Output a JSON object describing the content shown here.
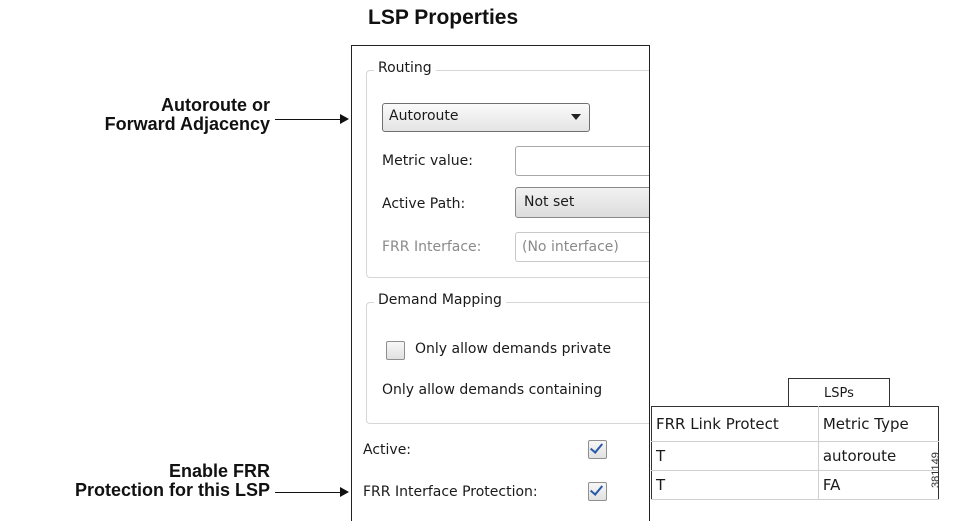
{
  "title": "LSP Properties",
  "callouts": {
    "autoroute_line1": "Autoroute or",
    "autoroute_line2": "Forward Adjacency",
    "frr_line1": "Enable FRR",
    "frr_line2": "Protection for this LSP"
  },
  "routing": {
    "group_label": "Routing",
    "autoroute_select": "Autoroute",
    "metric_label": "Metric value:",
    "metric_value": "",
    "active_path_label": "Active Path:",
    "active_path_value": "Not set",
    "frr_interface_label": "FRR Interface:",
    "frr_interface_value": "(No interface)"
  },
  "demand_mapping": {
    "group_label": "Demand Mapping",
    "private_checkbox_label": "Only allow demands private",
    "private_checked": false,
    "containing_label": "Only allow demands containing"
  },
  "active": {
    "label": "Active:",
    "checked": true
  },
  "frr_interface_protection": {
    "label": "FRR Interface Protection:",
    "checked": true
  },
  "lsps_table": {
    "tab_label": "LSPs",
    "columns": [
      "FRR Link Protect",
      "Metric Type"
    ],
    "rows": [
      [
        "T",
        "autoroute"
      ],
      [
        "T",
        "FA"
      ]
    ]
  },
  "figure_id": "381149",
  "colors": {
    "check_mark": "#2a59a8",
    "border": "#222222"
  }
}
